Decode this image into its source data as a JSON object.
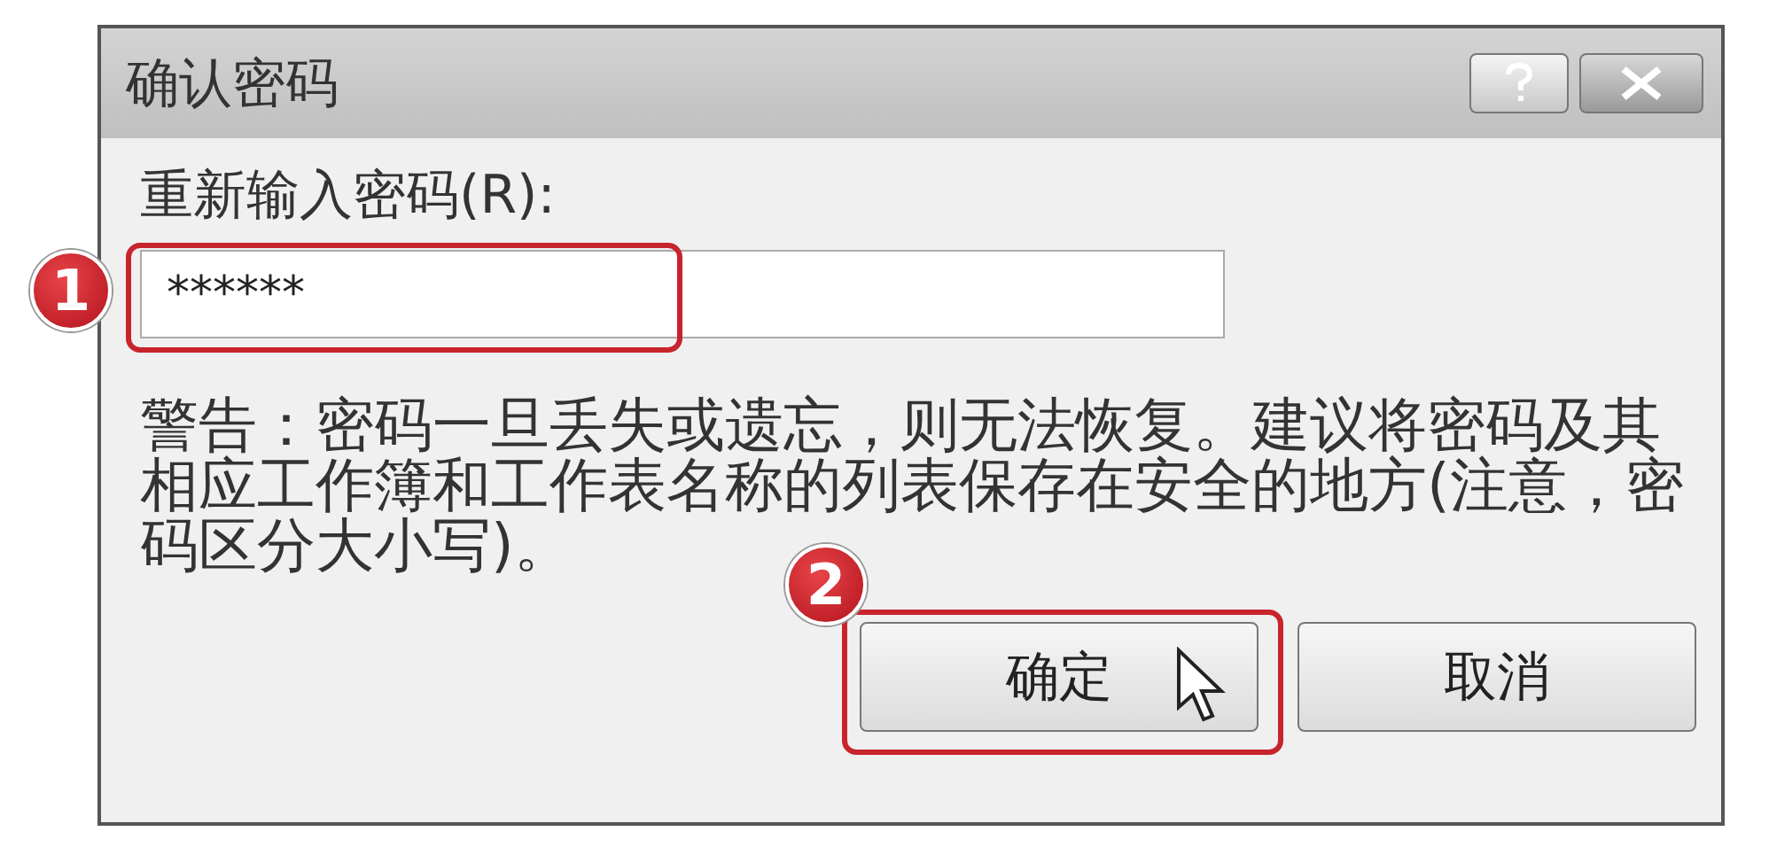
{
  "window": {
    "title": "确认密码"
  },
  "title_buttons": [
    {
      "kind": "help"
    },
    {
      "kind": "close"
    }
  ],
  "field": {
    "label": "重新输入密码(R):",
    "value": "******"
  },
  "warning": "警告：密码一旦丢失或遗忘，则无法恢复。建议将密码及其相应工作簿和工作表名称的列表保存在安全的地方(注意，密码区分大小写)。",
  "buttons": [
    {
      "label": "确定"
    },
    {
      "label": "取消"
    }
  ],
  "annotations": [
    {
      "number": "1"
    },
    {
      "number": "2"
    }
  ]
}
